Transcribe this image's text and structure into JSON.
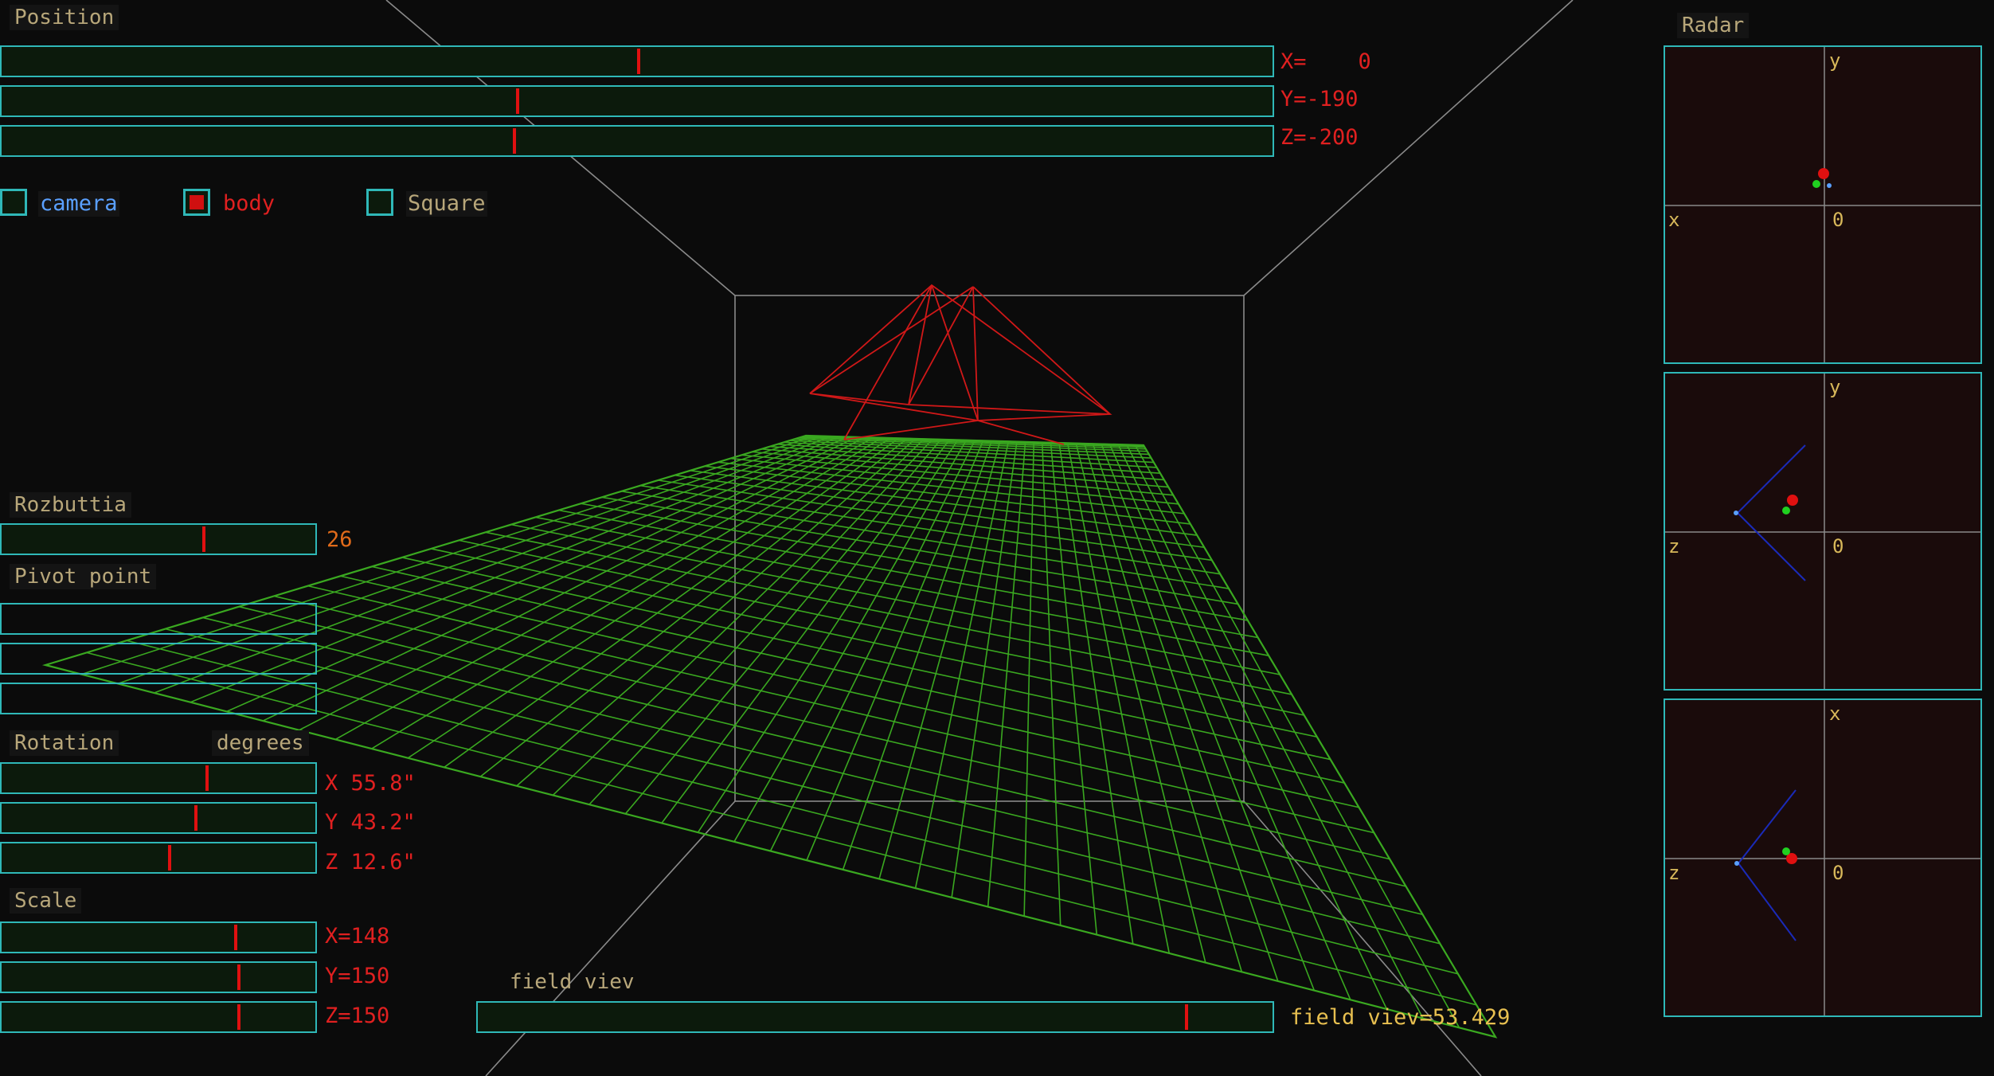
{
  "colors": {
    "background": "#0b0b0b",
    "slider_border": "#2fb8b8",
    "slider_thumb": "#e01010",
    "grid_green": "#3aa820",
    "pyramid_red": "#d01818",
    "label_text": "#b8a77a",
    "value_red": "#e02020",
    "value_orange": "#e06a1a"
  },
  "position": {
    "title": "Position",
    "x": {
      "label": "X=    0",
      "value": 0.5
    },
    "y": {
      "label": "Y=-190",
      "value": 0.405
    },
    "z": {
      "label": "Z=-200",
      "value": 0.402
    }
  },
  "toggles": [
    {
      "label": "camera",
      "checked": false,
      "color": "#5aa0ff"
    },
    {
      "label": "body",
      "checked": true,
      "color": "#e02020"
    },
    {
      "label": "Square",
      "checked": false,
      "color": "#b8a77a"
    }
  ],
  "rozbuttia": {
    "title": "Rozbuttia",
    "value_text": "26",
    "value": 0.64
  },
  "pivot": {
    "title": "Pivot point"
  },
  "rotation": {
    "title": "Rotation",
    "unit_label": "degrees",
    "x": {
      "label": "X 55.8\"",
      "value": 0.65
    },
    "y": {
      "label": "Y 43.2\"",
      "value": 0.615
    },
    "z": {
      "label": "Z 12.6\"",
      "value": 0.53
    }
  },
  "scale": {
    "title": "Scale",
    "x": {
      "label": "X=148",
      "value": 0.74
    },
    "y": {
      "label": "Y=150",
      "value": 0.75
    },
    "z": {
      "label": "Z=150",
      "value": 0.75
    }
  },
  "field_view": {
    "title": "field viev",
    "label": "field viev=53.429",
    "value": 0.89
  },
  "radar": {
    "title": "Radar",
    "panels": [
      {
        "top_axis": "y",
        "left_axis": "x",
        "origin": "0"
      },
      {
        "top_axis": "y",
        "left_axis": "z",
        "origin": "0"
      },
      {
        "top_axis": "x",
        "left_axis": "z",
        "origin": "0"
      }
    ]
  }
}
